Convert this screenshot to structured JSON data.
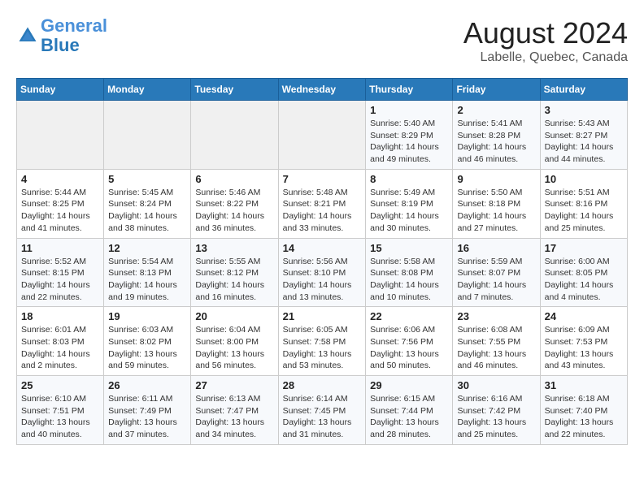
{
  "header": {
    "logo_line1": "General",
    "logo_line2": "Blue",
    "title": "August 2024",
    "subtitle": "Labelle, Quebec, Canada"
  },
  "days_of_week": [
    "Sunday",
    "Monday",
    "Tuesday",
    "Wednesday",
    "Thursday",
    "Friday",
    "Saturday"
  ],
  "weeks": [
    [
      {
        "day": "",
        "info": ""
      },
      {
        "day": "",
        "info": ""
      },
      {
        "day": "",
        "info": ""
      },
      {
        "day": "",
        "info": ""
      },
      {
        "day": "1",
        "info": "Sunrise: 5:40 AM\nSunset: 8:29 PM\nDaylight: 14 hours and 49 minutes."
      },
      {
        "day": "2",
        "info": "Sunrise: 5:41 AM\nSunset: 8:28 PM\nDaylight: 14 hours and 46 minutes."
      },
      {
        "day": "3",
        "info": "Sunrise: 5:43 AM\nSunset: 8:27 PM\nDaylight: 14 hours and 44 minutes."
      }
    ],
    [
      {
        "day": "4",
        "info": "Sunrise: 5:44 AM\nSunset: 8:25 PM\nDaylight: 14 hours and 41 minutes."
      },
      {
        "day": "5",
        "info": "Sunrise: 5:45 AM\nSunset: 8:24 PM\nDaylight: 14 hours and 38 minutes."
      },
      {
        "day": "6",
        "info": "Sunrise: 5:46 AM\nSunset: 8:22 PM\nDaylight: 14 hours and 36 minutes."
      },
      {
        "day": "7",
        "info": "Sunrise: 5:48 AM\nSunset: 8:21 PM\nDaylight: 14 hours and 33 minutes."
      },
      {
        "day": "8",
        "info": "Sunrise: 5:49 AM\nSunset: 8:19 PM\nDaylight: 14 hours and 30 minutes."
      },
      {
        "day": "9",
        "info": "Sunrise: 5:50 AM\nSunset: 8:18 PM\nDaylight: 14 hours and 27 minutes."
      },
      {
        "day": "10",
        "info": "Sunrise: 5:51 AM\nSunset: 8:16 PM\nDaylight: 14 hours and 25 minutes."
      }
    ],
    [
      {
        "day": "11",
        "info": "Sunrise: 5:52 AM\nSunset: 8:15 PM\nDaylight: 14 hours and 22 minutes."
      },
      {
        "day": "12",
        "info": "Sunrise: 5:54 AM\nSunset: 8:13 PM\nDaylight: 14 hours and 19 minutes."
      },
      {
        "day": "13",
        "info": "Sunrise: 5:55 AM\nSunset: 8:12 PM\nDaylight: 14 hours and 16 minutes."
      },
      {
        "day": "14",
        "info": "Sunrise: 5:56 AM\nSunset: 8:10 PM\nDaylight: 14 hours and 13 minutes."
      },
      {
        "day": "15",
        "info": "Sunrise: 5:58 AM\nSunset: 8:08 PM\nDaylight: 14 hours and 10 minutes."
      },
      {
        "day": "16",
        "info": "Sunrise: 5:59 AM\nSunset: 8:07 PM\nDaylight: 14 hours and 7 minutes."
      },
      {
        "day": "17",
        "info": "Sunrise: 6:00 AM\nSunset: 8:05 PM\nDaylight: 14 hours and 4 minutes."
      }
    ],
    [
      {
        "day": "18",
        "info": "Sunrise: 6:01 AM\nSunset: 8:03 PM\nDaylight: 14 hours and 2 minutes."
      },
      {
        "day": "19",
        "info": "Sunrise: 6:03 AM\nSunset: 8:02 PM\nDaylight: 13 hours and 59 minutes."
      },
      {
        "day": "20",
        "info": "Sunrise: 6:04 AM\nSunset: 8:00 PM\nDaylight: 13 hours and 56 minutes."
      },
      {
        "day": "21",
        "info": "Sunrise: 6:05 AM\nSunset: 7:58 PM\nDaylight: 13 hours and 53 minutes."
      },
      {
        "day": "22",
        "info": "Sunrise: 6:06 AM\nSunset: 7:56 PM\nDaylight: 13 hours and 50 minutes."
      },
      {
        "day": "23",
        "info": "Sunrise: 6:08 AM\nSunset: 7:55 PM\nDaylight: 13 hours and 46 minutes."
      },
      {
        "day": "24",
        "info": "Sunrise: 6:09 AM\nSunset: 7:53 PM\nDaylight: 13 hours and 43 minutes."
      }
    ],
    [
      {
        "day": "25",
        "info": "Sunrise: 6:10 AM\nSunset: 7:51 PM\nDaylight: 13 hours and 40 minutes."
      },
      {
        "day": "26",
        "info": "Sunrise: 6:11 AM\nSunset: 7:49 PM\nDaylight: 13 hours and 37 minutes."
      },
      {
        "day": "27",
        "info": "Sunrise: 6:13 AM\nSunset: 7:47 PM\nDaylight: 13 hours and 34 minutes."
      },
      {
        "day": "28",
        "info": "Sunrise: 6:14 AM\nSunset: 7:45 PM\nDaylight: 13 hours and 31 minutes."
      },
      {
        "day": "29",
        "info": "Sunrise: 6:15 AM\nSunset: 7:44 PM\nDaylight: 13 hours and 28 minutes."
      },
      {
        "day": "30",
        "info": "Sunrise: 6:16 AM\nSunset: 7:42 PM\nDaylight: 13 hours and 25 minutes."
      },
      {
        "day": "31",
        "info": "Sunrise: 6:18 AM\nSunset: 7:40 PM\nDaylight: 13 hours and 22 minutes."
      }
    ]
  ]
}
